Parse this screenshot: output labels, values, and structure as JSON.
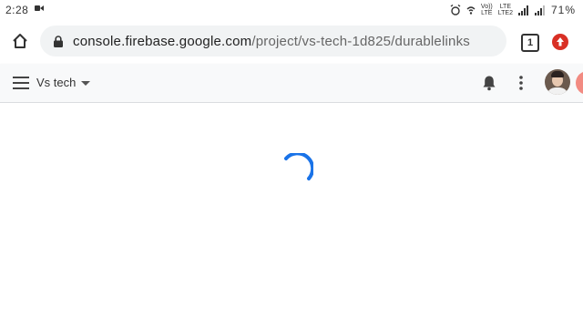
{
  "status_bar": {
    "time": "2:28",
    "signal_label_top": "Vo))",
    "signal_label_bottom": "LTE",
    "lte_label_top": "LTE",
    "lte_label_bottom": "LTE2",
    "battery_percent": "71%"
  },
  "browser": {
    "url_domain": "console.firebase.google.com",
    "url_path": "/project/vs-tech-1d825/durablelinks",
    "tab_count": "1"
  },
  "app_header": {
    "project_name": "Vs tech"
  },
  "colors": {
    "spinner": "#1a73e8",
    "update_badge": "#d93025",
    "fab": "#f28b82"
  },
  "icons": {
    "home": "home-icon",
    "lock": "lock-icon",
    "menu": "menu-icon",
    "bell": "bell-icon",
    "more": "more-vert-icon",
    "spinner": "loading-spinner"
  }
}
